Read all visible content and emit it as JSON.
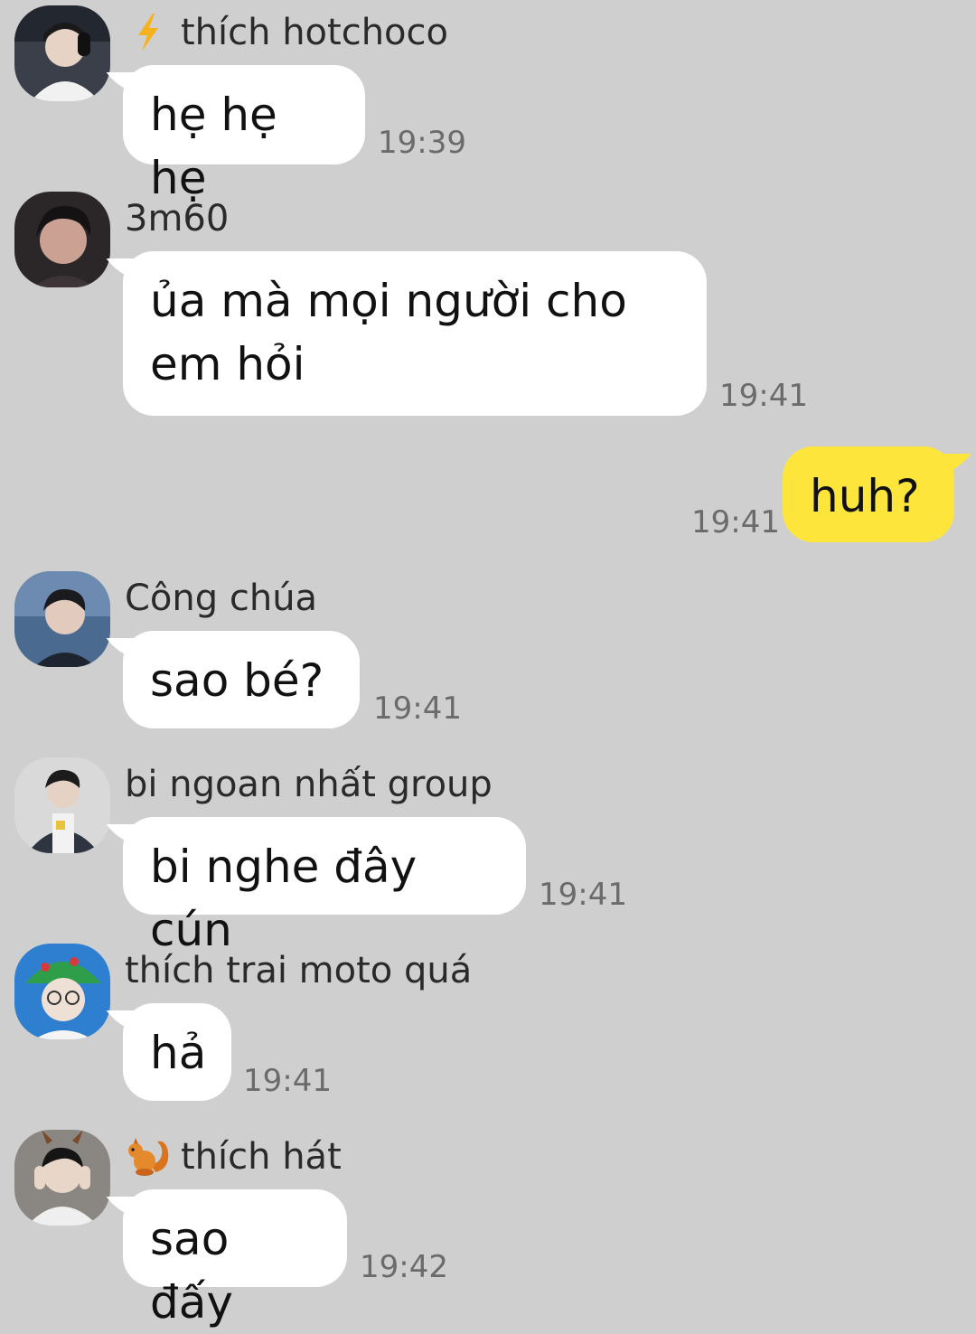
{
  "messages": [
    {
      "sender": "thích hotchoco",
      "badge": "lightning-icon",
      "text": "hẹ hẹ hẹ",
      "time": "19:39",
      "avatar_bg": "#3a3f4a"
    },
    {
      "sender": "3m60",
      "badge": "",
      "text": "ủa mà mọi người cho em hỏi",
      "time": "19:41",
      "avatar_bg": "#2b2628"
    },
    {
      "mine": true,
      "text": "huh?",
      "time": "19:41",
      "bubble_color": "#fde53b"
    },
    {
      "sender": "Công chúa",
      "badge": "",
      "text": "sao bé?",
      "time": "19:41",
      "avatar_bg": "#4b6a8f"
    },
    {
      "sender": "bi ngoan nhất group",
      "badge": "",
      "text": "bi nghe đây cún",
      "time": "19:41",
      "avatar_bg": "#5a5f66"
    },
    {
      "sender": "thích trai moto quá",
      "badge": "",
      "text": "hả",
      "time": "19:41",
      "avatar_bg": "#2f7fd0"
    },
    {
      "sender": "thích hát",
      "badge": "squirrel-icon",
      "text": "sao đấy",
      "time": "19:42",
      "avatar_bg": "#6e6a66"
    }
  ],
  "colors": {
    "background": "#cfcfcf",
    "bubble_other": "#ffffff",
    "bubble_mine": "#fde53b",
    "timestamp": "#6b6b6b"
  }
}
